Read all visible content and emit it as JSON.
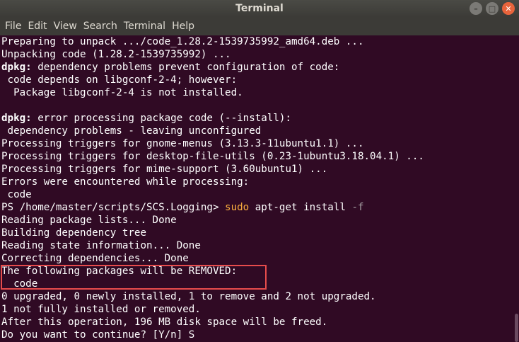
{
  "window": {
    "title": "Terminal",
    "controls": {
      "minimize_glyph": "–",
      "maximize_glyph": "□",
      "close_glyph": "✕"
    }
  },
  "menubar": {
    "items": [
      "File",
      "Edit",
      "View",
      "Search",
      "Terminal",
      "Help"
    ]
  },
  "terminal": {
    "colors": {
      "background": "#300a24",
      "foreground": "#ffffff",
      "command": "#fcaf3e",
      "highlight_border": "#e74c4c"
    },
    "lines": [
      "Preparing to unpack .../code_1.28.2-1539735992_amd64.deb ...",
      "Unpacking code (1.28.2-1539735992) ...",
      {
        "bold": "dpkg:",
        "text": " dependency problems prevent configuration of code:"
      },
      " code depends on libgconf-2-4; however:",
      "  Package libgconf-2-4 is not installed.",
      "",
      {
        "bold": "dpkg:",
        "text": " error processing package code (--install):"
      },
      " dependency problems - leaving unconfigured",
      "Processing triggers for gnome-menus (3.13.3-11ubuntu1.1) ...",
      "Processing triggers for desktop-file-utils (0.23-1ubuntu3.18.04.1) ...",
      "Processing triggers for mime-support (3.60ubuntu1) ...",
      "Errors were encountered while processing:",
      " code",
      {
        "prompt": "PS /home/master/scripts/SCS.Logging> ",
        "command": "sudo",
        "args": " apt-get install ",
        "flag": "-f"
      },
      "Reading package lists... Done",
      "Building dependency tree",
      "Reading state information... Done",
      "Correcting dependencies... Done",
      "The following packages will be REMOVED:",
      "  code",
      "0 upgraded, 0 newly installed, 1 to remove and 2 not upgraded.",
      "1 not fully installed or removed.",
      "After this operation, 196 MB disk space will be freed.",
      "Do you want to continue? [Y/n] S"
    ]
  }
}
